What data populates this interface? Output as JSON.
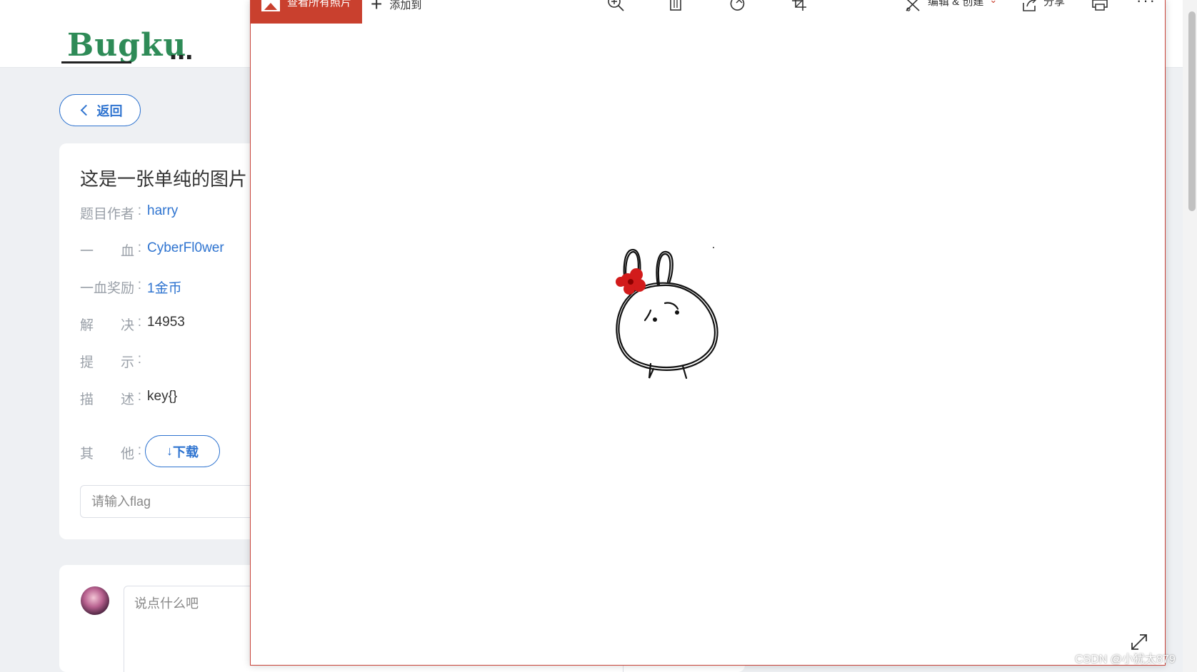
{
  "site": {
    "logo_text": "Bugku",
    "logo_suffix": "..."
  },
  "page": {
    "back_label": "返回",
    "challenge_title": "这是一张单纯的图片",
    "info": [
      {
        "label": "题目作者",
        "value": "harry",
        "link": true
      },
      {
        "label": "一　　血",
        "value": "CyberFl0wer",
        "link": true
      },
      {
        "label": "一血奖励",
        "value": "1金币",
        "link": true
      },
      {
        "label": "解　　决",
        "value": "14953",
        "link": false
      },
      {
        "label": "提　　示",
        "value": "",
        "link": false
      },
      {
        "label": "描　　述",
        "value": "key{}",
        "link": false
      },
      {
        "label": "其　　他",
        "value": "",
        "link": false
      }
    ],
    "download_label": "下载",
    "flag_placeholder": "请输入flag",
    "comment_placeholder": "说点什么吧"
  },
  "viewer": {
    "all_photos_label": "查看所有照片",
    "add_to_label": "添加到",
    "edit_create_label": "编辑 & 创建",
    "share_label": "分享",
    "more_label": "···",
    "icons": [
      "zoom-icon",
      "delete-icon",
      "rotate-icon",
      "crop-icon",
      "edit-create-icon",
      "share-icon",
      "print-icon",
      "fullscreen-icon"
    ]
  },
  "watermark": "CSDN @小犹太879",
  "colors": {
    "accent_blue": "#2f74d0",
    "viewer_red": "#c9402e",
    "logo_green": "#2e8b57"
  }
}
